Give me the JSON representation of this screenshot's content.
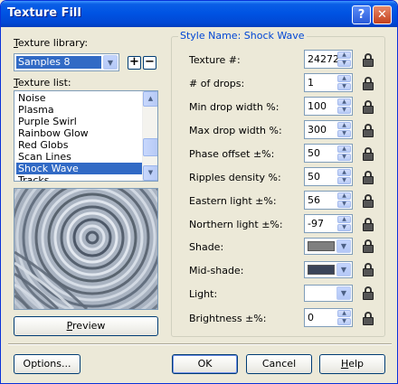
{
  "window": {
    "title": "Texture Fill",
    "help_symbol": "?",
    "close_symbol": "✕"
  },
  "library": {
    "label_prefix": "T",
    "label_rest": "exture library:",
    "selected": "Samples 8",
    "add_symbol": "+",
    "remove_symbol": "−"
  },
  "texture_list": {
    "label_prefix": "T",
    "label_rest": "exture list:",
    "items": [
      "Noise",
      "Plasma",
      "Purple Swirl",
      "Rainbow Glow",
      "Red Globs",
      "Scan Lines",
      "Shock Wave",
      "Tracks"
    ],
    "selected": "Shock Wave"
  },
  "preview_button": {
    "label_prefix": "P",
    "label_rest": "review"
  },
  "style": {
    "group_title": "Style Name: Shock Wave",
    "fields": [
      {
        "label": "Texture #:",
        "value": "24272"
      },
      {
        "label": "# of drops:",
        "value": "1"
      },
      {
        "label": "Min drop width %:",
        "value": "100"
      },
      {
        "label": "Max drop width %:",
        "value": "300"
      },
      {
        "label": "Phase offset ±%:",
        "value": "50"
      },
      {
        "label": "Ripples density %:",
        "value": "50"
      },
      {
        "label": "Eastern light ±%:",
        "value": "56"
      },
      {
        "label": "Northern light ±%:",
        "value": "-97"
      }
    ],
    "colors": [
      {
        "label": "Shade:",
        "color": "#7f7f7f"
      },
      {
        "label": "Mid-shade:",
        "color": "#3a4458"
      },
      {
        "label": "Light:",
        "color": "#ffffff"
      }
    ],
    "brightness": {
      "label": "Brightness ±%:",
      "value": "0"
    }
  },
  "footer": {
    "options": "Options...",
    "options_mnemonic_index": 0,
    "ok": "OK",
    "cancel": "Cancel",
    "help_prefix": "H",
    "help_rest": "elp"
  },
  "icons": {
    "dropdown": "chevron-down-icon",
    "spin_up": "spin-up-icon",
    "spin_down": "spin-down-icon",
    "lock": "lock-icon"
  },
  "colors": {
    "title_bar": "#0054e3",
    "selection": "#316ac5",
    "group_title": "#0046d5",
    "dialog_bg": "#ece9d8"
  }
}
